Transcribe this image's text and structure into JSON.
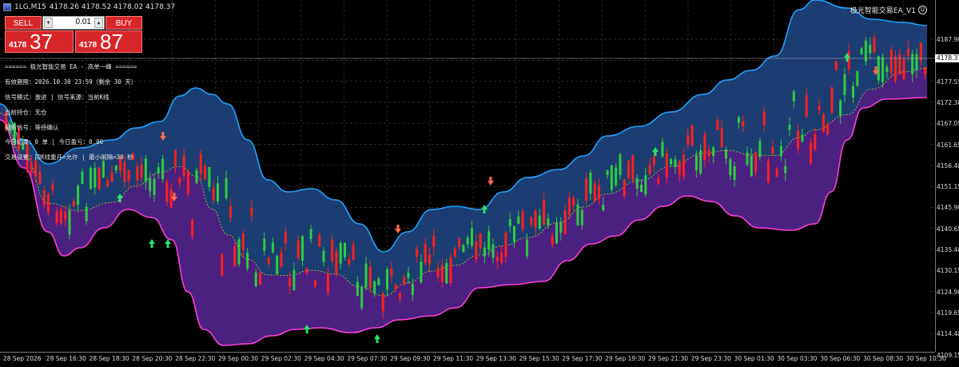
{
  "window": {
    "symbol": "1LG,M15",
    "ohlc": "4178.26 4178.52 4178.02 4178.37",
    "ea_name": "极光智能交易EA_V1",
    "ea_icon": "smiley-icon"
  },
  "trade_panel": {
    "sell_label": "SELL",
    "buy_label": "BUY",
    "lot": "0.01",
    "sell_price_small": "4178",
    "sell_price_big": "37",
    "buy_price_small": "4178",
    "buy_price_big": "87"
  },
  "info_panel": {
    "lines": [
      "====== 极光智能交易 EA - 高单一峰 ======",
      "有效期限：2026.10.30 23:59（剩余 30 天）",
      "信号模式：激进 | 信号来源：当前K线",
      "当前持仓：无仓",
      "最新信号：等待确认",
      "今日结果：0 单 | 今日盈亏：0.00",
      "交易设置：同K线重开=允许 | 最小间隔=30 秒"
    ]
  },
  "price_axis": {
    "labels": [
      "4187.90",
      "4182.80",
      "4177.55",
      "4172.30",
      "4167.05",
      "4161.65",
      "4156.40",
      "4151.15",
      "4145.90",
      "4140.65",
      "4135.40",
      "4130.15",
      "4124.90",
      "4119.65",
      "4114.40",
      "4109.15"
    ],
    "current_price": "4178.37"
  },
  "time_axis": {
    "labels": [
      "28 Sep 2026",
      "28 Sep 16:30",
      "28 Sep 18:30",
      "28 Sep 20:30",
      "28 Sep 22:30",
      "29 Sep 00:30",
      "29 Sep 02:30",
      "29 Sep 04:30",
      "29 Sep 07:30",
      "29 Sep 09:30",
      "29 Sep 11:30",
      "29 Sep 13:30",
      "29 Sep 15:30",
      "29 Sep 17:30",
      "29 Sep 19:30",
      "29 Sep 21:30",
      "29 Sep 23:30",
      "30 Sep 01:30",
      "30 Sep 03:30",
      "30 Sep 06:30",
      "30 Sep 08:30",
      "30 Sep 10:30"
    ]
  },
  "colors": {
    "background": "#000000",
    "bull_candle": "#2ecc40",
    "bear_candle": "#ff2020",
    "upper_band": "#1fa4ff",
    "lower_band": "#ff3fd8",
    "upper_fill": "#1c3d72",
    "lower_fill": "#4a2180",
    "mid_line": "#c8c832",
    "buy_arrow": "#2ee06a",
    "sell_arrow": "#ff6a4a"
  }
}
